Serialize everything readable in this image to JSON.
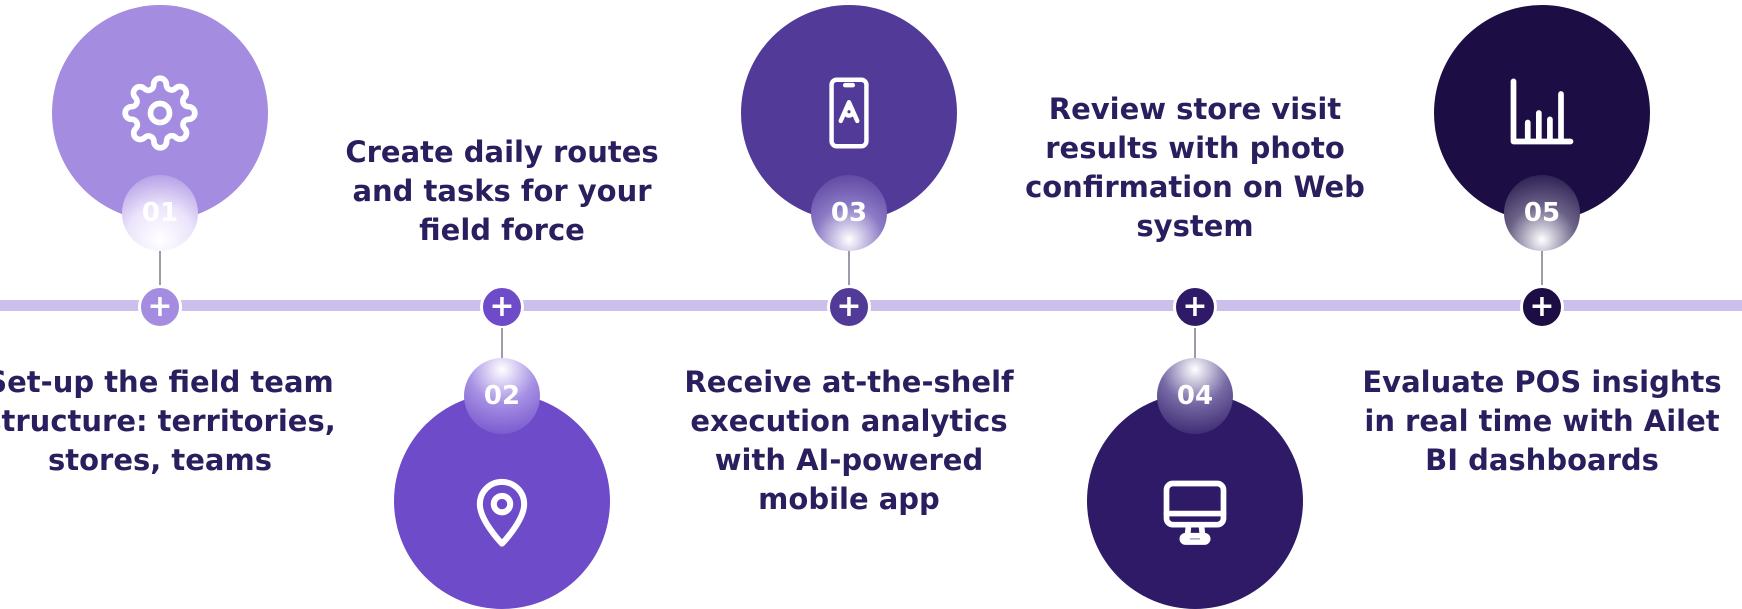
{
  "steps": [
    {
      "number": "01",
      "text": "Set-up the field team structure: territories, stores, teams",
      "icon": "gear-icon",
      "color": "#a48ce0",
      "badge_color": "#ebe4fb"
    },
    {
      "number": "02",
      "text": "Create daily routes and tasks for your field force",
      "icon": "location-pin-icon",
      "color": "#6e4bc8",
      "badge_color": "#a690e4"
    },
    {
      "number": "03",
      "text": "Receive at-the-shelf execution analytics with AI-powered mobile app",
      "icon": "mobile-app-icon",
      "color": "#523a99",
      "badge_color": "#8d7bc6"
    },
    {
      "number": "04",
      "text": "Review store visit results with photo confirmation on Web system",
      "icon": "monitor-icon",
      "color": "#2e1a66",
      "badge_color": "#776aa5"
    },
    {
      "number": "05",
      "text": "Evaluate POS insights in real time with Ailet BI dashboards",
      "icon": "bar-chart-icon",
      "color": "#1c0d45",
      "badge_color": "#6c6388"
    }
  ]
}
